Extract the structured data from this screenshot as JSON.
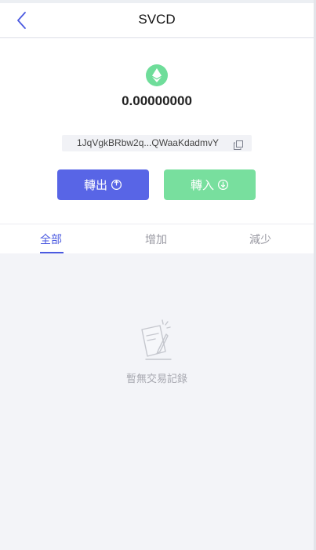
{
  "header": {
    "title": "SVCD"
  },
  "wallet": {
    "balance": "0.00000000",
    "address": "1JqVgkBRbw2q...QWaaKdadmvY"
  },
  "actions": {
    "transfer_out": "轉出",
    "transfer_in": "轉入"
  },
  "tabs": [
    {
      "label": "全部"
    },
    {
      "label": "增加"
    },
    {
      "label": "減少"
    }
  ],
  "empty": {
    "message": "暫無交易記錄"
  },
  "colors": {
    "accent": "#4b5ae0",
    "out_button": "#5865e6",
    "in_button": "#78df9e",
    "coin": "#6fdd9a"
  }
}
